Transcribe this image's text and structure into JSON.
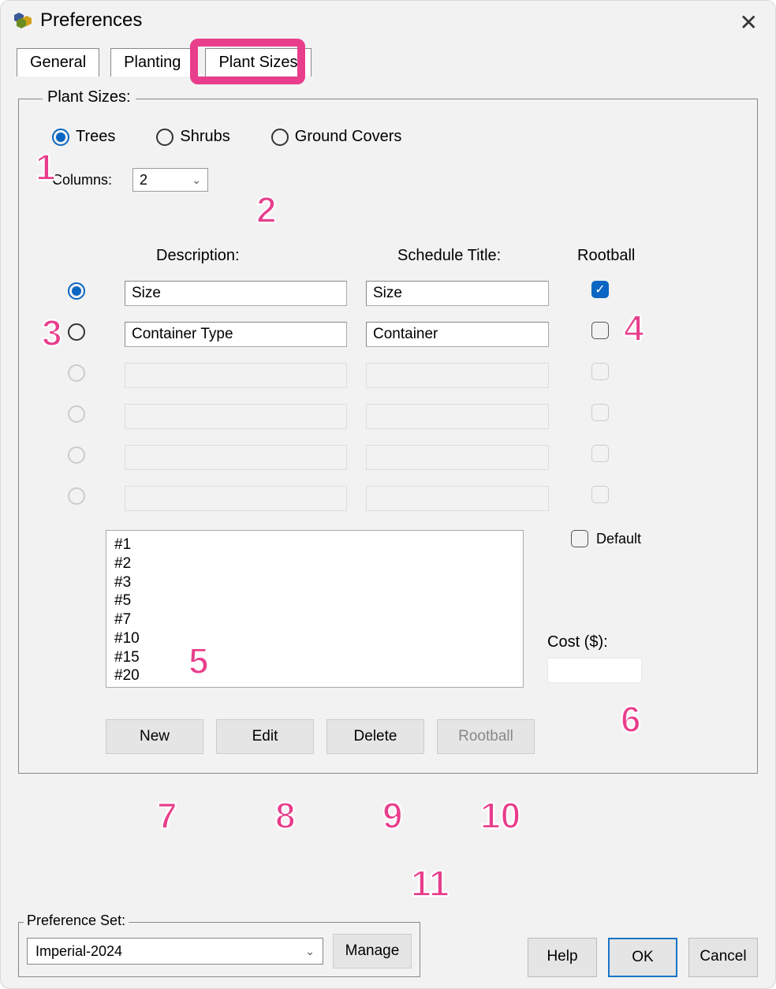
{
  "window": {
    "title": "Preferences"
  },
  "tabs": {
    "general": "General",
    "planting": "Planting",
    "plant_sizes": "Plant Sizes"
  },
  "group": {
    "legend": "Plant Sizes:",
    "type_radios": {
      "trees": "Trees",
      "shrubs": "Shrubs",
      "ground_covers": "Ground Covers"
    },
    "columns_label": "Columns:",
    "columns_value": "2",
    "headers": {
      "description": "Description:",
      "schedule_title": "Schedule Title:",
      "rootball": "Rootball"
    },
    "rows": [
      {
        "description": "Size",
        "schedule": "Size",
        "rootball": true
      },
      {
        "description": "Container Type",
        "schedule": "Container",
        "rootball": false
      }
    ],
    "list_items": [
      "#1",
      "#2",
      "#3",
      "#5",
      "#7",
      "#10",
      "#15",
      "#20"
    ],
    "default_label": "Default",
    "cost_label": "Cost ($):",
    "buttons": {
      "new": "New",
      "edit": "Edit",
      "delete": "Delete",
      "rootball": "Rootball"
    }
  },
  "pref_set": {
    "legend": "Preference Set:",
    "value": "Imperial-2024",
    "manage": "Manage"
  },
  "footer": {
    "help": "Help",
    "ok": "OK",
    "cancel": "Cancel"
  },
  "markers": {
    "m1": "1",
    "m2": "2",
    "m3": "3",
    "m4": "4",
    "m5": "5",
    "m6": "6",
    "m7": "7",
    "m8": "8",
    "m9": "9",
    "m10": "10",
    "m11": "11"
  }
}
